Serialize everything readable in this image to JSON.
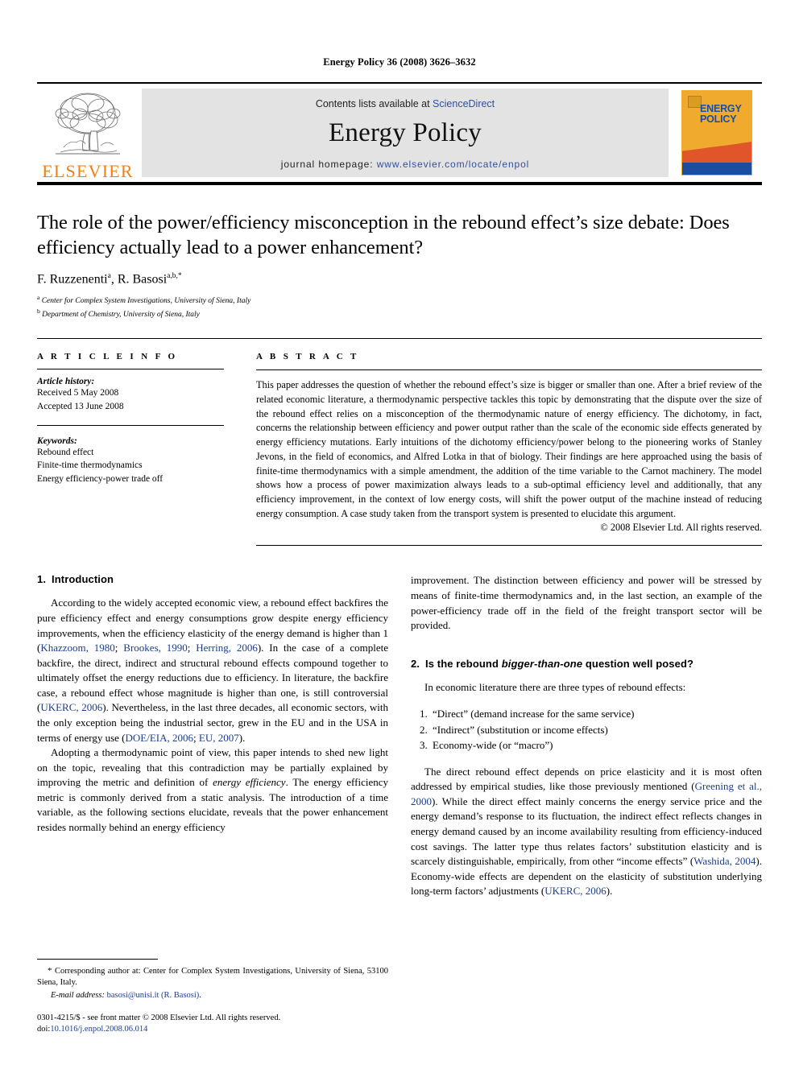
{
  "running_head": "Energy Policy 36 (2008) 3626–3632",
  "masthead": {
    "publisher_name": "ELSEVIER",
    "contents_prefix": "Contents lists available at ",
    "contents_link": "ScienceDirect",
    "journal_name": "Energy Policy",
    "homepage_prefix": "journal homepage: ",
    "homepage_url": "www.elsevier.com/locate/enpol",
    "cover_title_line1": "ENERGY",
    "cover_title_line2": "POLICY"
  },
  "colors": {
    "elsevier_orange": "#ef7f1a",
    "link_blue": "#2f4f9e",
    "citation_blue": "#1b3e8c",
    "cover_yellow": "#f0ab2e",
    "cover_red": "#e0562a",
    "cover_blue": "#1b4ea0",
    "masthead_grey": "#e3e3e3"
  },
  "article": {
    "title": "The role of the power/efficiency misconception in the rebound effect’s size debate: Does efficiency actually lead to a power enhancement?",
    "authors": "F. Ruzzenenti",
    "author_sup_1": "a",
    "authors_2": ", R. Basosi",
    "author_sup_2": "a,b,*",
    "affiliations": [
      {
        "marker": "a",
        "text": "Center for Complex System Investigations, University of Siena, Italy"
      },
      {
        "marker": "b",
        "text": "Department of Chemistry, University of Siena, Italy"
      }
    ]
  },
  "article_info": {
    "heading": "A R T I C L E   I N F O",
    "history_label": "Article history:",
    "history_lines": [
      "Received 5 May 2008",
      "Accepted 13 June 2008"
    ],
    "keywords_label": "Keywords:",
    "keywords": [
      "Rebound effect",
      "Finite-time thermodynamics",
      "Energy efficiency-power trade off"
    ]
  },
  "abstract": {
    "heading": "A B S T R A C T",
    "text": "This paper addresses the question of whether the rebound effect’s size is bigger or smaller than one. After a brief review of the related economic literature, a thermodynamic perspective tackles this topic by demonstrating that the dispute over the size of the rebound effect relies on a misconception of the thermodynamic nature of energy efficiency. The dichotomy, in fact, concerns the relationship between efficiency and power output rather than the scale of the economic side effects generated by energy efficiency mutations. Early intuitions of the dichotomy efficiency/power belong to the pioneering works of Stanley Jevons, in the field of economics, and Alfred Lotka in that of biology. Their findings are here approached using the basis of finite-time thermodynamics with a simple amendment, the addition of the time variable to the Carnot machinery. The model shows how a process of power maximization always leads to a sub-optimal efficiency level and additionally, that any efficiency improvement, in the context of low energy costs, will shift the power output of the machine instead of reducing energy consumption. A case study taken from the transport system is presented to elucidate this argument.",
    "copyright": "© 2008 Elsevier Ltd. All rights reserved."
  },
  "sections": {
    "intro": {
      "number": "1.",
      "title": "Introduction",
      "p1_a": "According to the widely accepted economic view, a rebound effect backfires the pure efficiency effect and energy consumptions grow despite energy efficiency improvements, when the efficiency elasticity of the energy demand is higher than 1 (",
      "p1_cite1": "Khazzoom, 1980",
      "p1_sep1": "; ",
      "p1_cite2": "Brookes, 1990",
      "p1_sep2": "; ",
      "p1_cite3": "Herring, 2006",
      "p1_b": "). In the case of a complete backfire, the direct, indirect and structural rebound effects compound together to ultimately offset the energy reductions due to efficiency. In literature, the backfire case, a rebound effect whose magnitude is higher than one, is still controversial (",
      "p1_cite4": "UKERC, 2006",
      "p1_c": "). Nevertheless, in the last three decades, all economic sectors, with the only exception being the industrial sector, grew in the EU and in the USA in terms of energy use (",
      "p1_cite5": "DOE/EIA, 2006",
      "p1_sep3": "; ",
      "p1_cite6": "EU, 2007",
      "p1_d": ").",
      "p2_a": "Adopting a thermodynamic point of view, this paper intends to shed new light on the topic, revealing that this contradiction may be partially explained by improving the metric and definition of ",
      "p2_ital": "energy efficiency",
      "p2_b": ". The energy efficiency metric is commonly derived from a static analysis. The introduction of a time variable, as the following sections elucidate, reveals that the power enhancement resides normally behind an energy efficiency improvement. The distinction between efficiency and power will be stressed by means of finite-time thermodynamics and, in the last section, an example of the power-efficiency trade off in the field of the freight transport sector will be provided."
    },
    "sec2": {
      "number": "2.",
      "title_a": "Is the rebound ",
      "title_ital": "bigger-than-one",
      "title_b": " question well posed?",
      "lead": "In economic literature there are three types of rebound effects:",
      "list": [
        "“Direct” (demand increase for the same service)",
        "“Indirect” (substitution or income effects)",
        "Economy-wide (or “macro”)"
      ],
      "p1_a": "The direct rebound effect depends on price elasticity and it is most often addressed by empirical studies, like those previously mentioned (",
      "p1_cite1": "Greening et al., 2000",
      "p1_b": "). While the direct effect mainly concerns the energy service price and the energy demand’s response to its fluctuation, the indirect effect reflects changes in energy demand caused by an income availability resulting from efficiency-induced cost savings. The latter type thus relates factors’ substitution elasticity and is scarcely distinguishable, empirically, from other “income effects” (",
      "p1_cite2": "Washida, 2004",
      "p1_c": "). Economy-wide effects are dependent on the elasticity of substitution underlying long-term factors’ adjustments (",
      "p1_cite3": "UKERC, 2006",
      "p1_d": ")."
    }
  },
  "footnotes": {
    "corresponding_star": "*",
    "corresponding_text": " Corresponding author at: Center for Complex System Investigations, University of Siena, 53100 Siena, Italy.",
    "email_label": "E-mail address:",
    "email_value": "basosi@unisi.it (R. Basosi)",
    "email_suffix": ".",
    "issn_line": "0301-4215/$ - see front matter © 2008 Elsevier Ltd. All rights reserved.",
    "doi_label": "doi:",
    "doi_value": "10.1016/j.enpol.2008.06.014"
  }
}
